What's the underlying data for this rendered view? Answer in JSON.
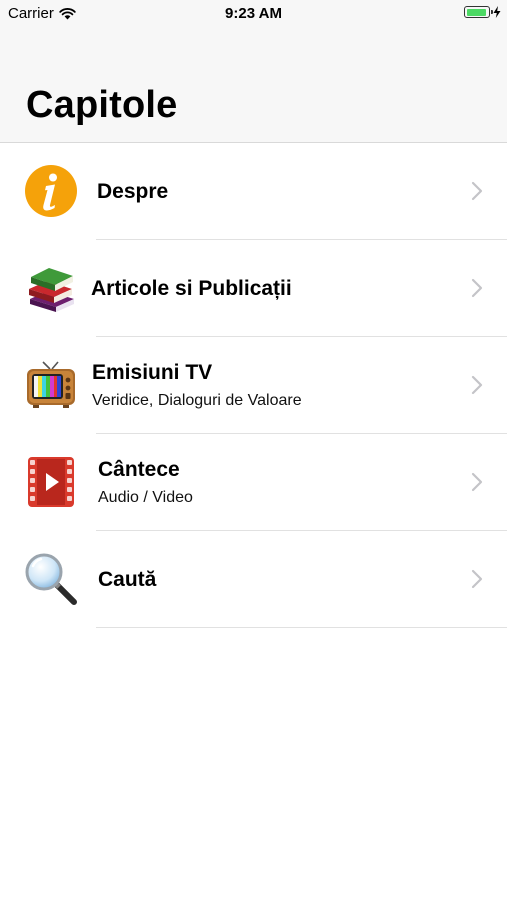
{
  "status_bar": {
    "carrier": "Carrier",
    "time": "9:23 AM",
    "battery_color": "#4cd964"
  },
  "header": {
    "title": "Capitole"
  },
  "rows": [
    {
      "title": "Despre",
      "subtitle": "",
      "icon": "info-icon"
    },
    {
      "title": "Articole si Publicații",
      "subtitle": "",
      "icon": "books-icon"
    },
    {
      "title": "Emisiuni TV",
      "subtitle": "Veridice, Dialoguri de Valoare",
      "icon": "tv-icon"
    },
    {
      "title": "Cântece",
      "subtitle": "Audio / Video",
      "icon": "video-player-icon"
    },
    {
      "title": "Caută",
      "subtitle": "",
      "icon": "magnifier-icon"
    }
  ]
}
